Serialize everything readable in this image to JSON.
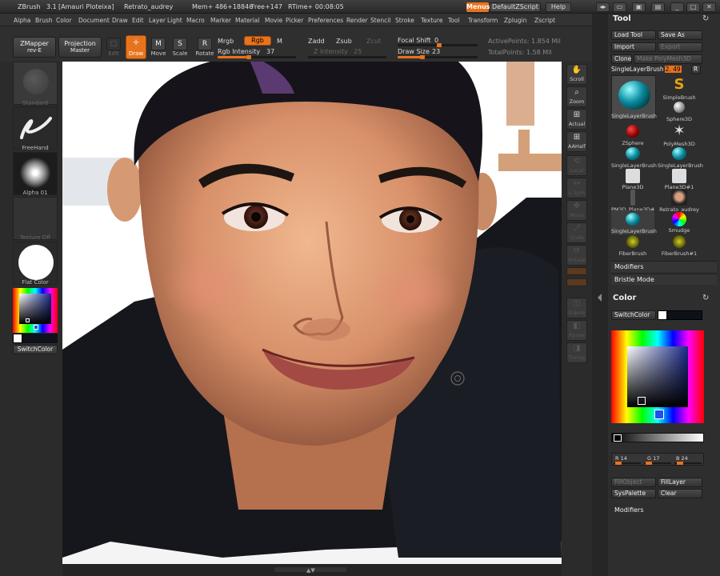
{
  "titlebar": {
    "app": "ZBrush",
    "version": "3.1",
    "author": "[Amauri Ploteixa]",
    "document": "Retrato_audrey",
    "mem": "Mem+ 486+18846",
    "free": "Free+147",
    "rtime": "RTime+ 00:08:05",
    "menus": "Menus",
    "script": "DefaultZScript",
    "help": "Help"
  },
  "menubar": {
    "items": [
      "Alpha",
      "Brush",
      "Color",
      "Document",
      "Draw",
      "Edit",
      "Layer",
      "Light",
      "Macro",
      "Marker",
      "Material",
      "Movie",
      "Picker",
      "Preferences",
      "Render",
      "Stencil",
      "Stroke",
      "Texture",
      "Tool",
      "Transform",
      "Zplugin",
      "Zscript"
    ]
  },
  "toolbar": {
    "zmapper": "ZMapper",
    "zmapper_sub": "rev-E",
    "projection": "Projection",
    "projection_sub": "Master",
    "edit": "Edit",
    "draw": "Draw",
    "move": "Move",
    "scale": "Scale",
    "rotate": "Rotate",
    "mrgb": "Mrgb",
    "rgb": "Rgb",
    "m": "M",
    "rgb_intensity_label": "Rgb Intensity",
    "rgb_intensity": "37",
    "zadd": "Zadd",
    "zsub": "Zsub",
    "zcut": "Zcut",
    "z_intensity_label": "Z Intensity",
    "z_intensity": "25",
    "focal_shift_label": "Focal Shift",
    "focal_shift": "0",
    "draw_size_label": "Draw Size",
    "draw_size": "23",
    "active_points": "ActivePoints: 1.854 Mil",
    "total_points": "TotalPoints: 1.58 Mil"
  },
  "leftshelf": {
    "standard": "Standard",
    "freehand": "FreeHand",
    "alpha": "Alpha 01",
    "texture": "Texture Off",
    "flat_color": "Flat Color",
    "switch_color": "SwitchColor"
  },
  "rightshelf": {
    "scroll": "Scroll",
    "zoom": "Zoom",
    "actual": "Actual",
    "aahalf": "AAHalf",
    "local": "Local",
    "lsym": "L.Sym",
    "move": "Move",
    "scale": "Scale",
    "rotate": "Rotate",
    "frame": "Frame",
    "xpose": "Xpose",
    "transp": "Transp"
  },
  "toolpanel": {
    "title": "Tool",
    "load_tool": "Load Tool",
    "save_as": "Save As",
    "import": "Import",
    "export": "Export",
    "clone": "Clone",
    "make_polymesh": "Make PolyMesh3D",
    "current_tool": "SingleLayerBrush",
    "current_value": "2. 49",
    "r": "R",
    "tools": [
      {
        "label": "SingleLayerBrush"
      },
      {
        "label": "SimpleBrush"
      },
      {
        "label": "Sphere3D"
      },
      {
        "label": "ZSphere"
      },
      {
        "label": "PolyMesh3D"
      },
      {
        "label": "SingleLayerBrush"
      },
      {
        "label": "SingleLayerBrush"
      },
      {
        "label": "Plane3D"
      },
      {
        "label": "Plane3D#1"
      },
      {
        "label": "PM3D_Plane3D#"
      },
      {
        "label": "Retrato_audrey"
      },
      {
        "label": "SingleLayerBrush"
      },
      {
        "label": "Smudge"
      },
      {
        "label": "FiberBrush"
      },
      {
        "label": "FiberBrush#1"
      }
    ],
    "modifiers": "Modifiers",
    "bristle_mode": "Bristle Mode"
  },
  "colorpanel": {
    "title": "Color",
    "switch_color": "SwitchColor",
    "r_label": "R 14",
    "g_label": "G 17",
    "b_label": "B 24",
    "fill_object": "FillObject",
    "fill_layer": "FillLayer",
    "syspalette": "SysPalette",
    "clear": "Clear",
    "modifiers": "Modifiers"
  }
}
